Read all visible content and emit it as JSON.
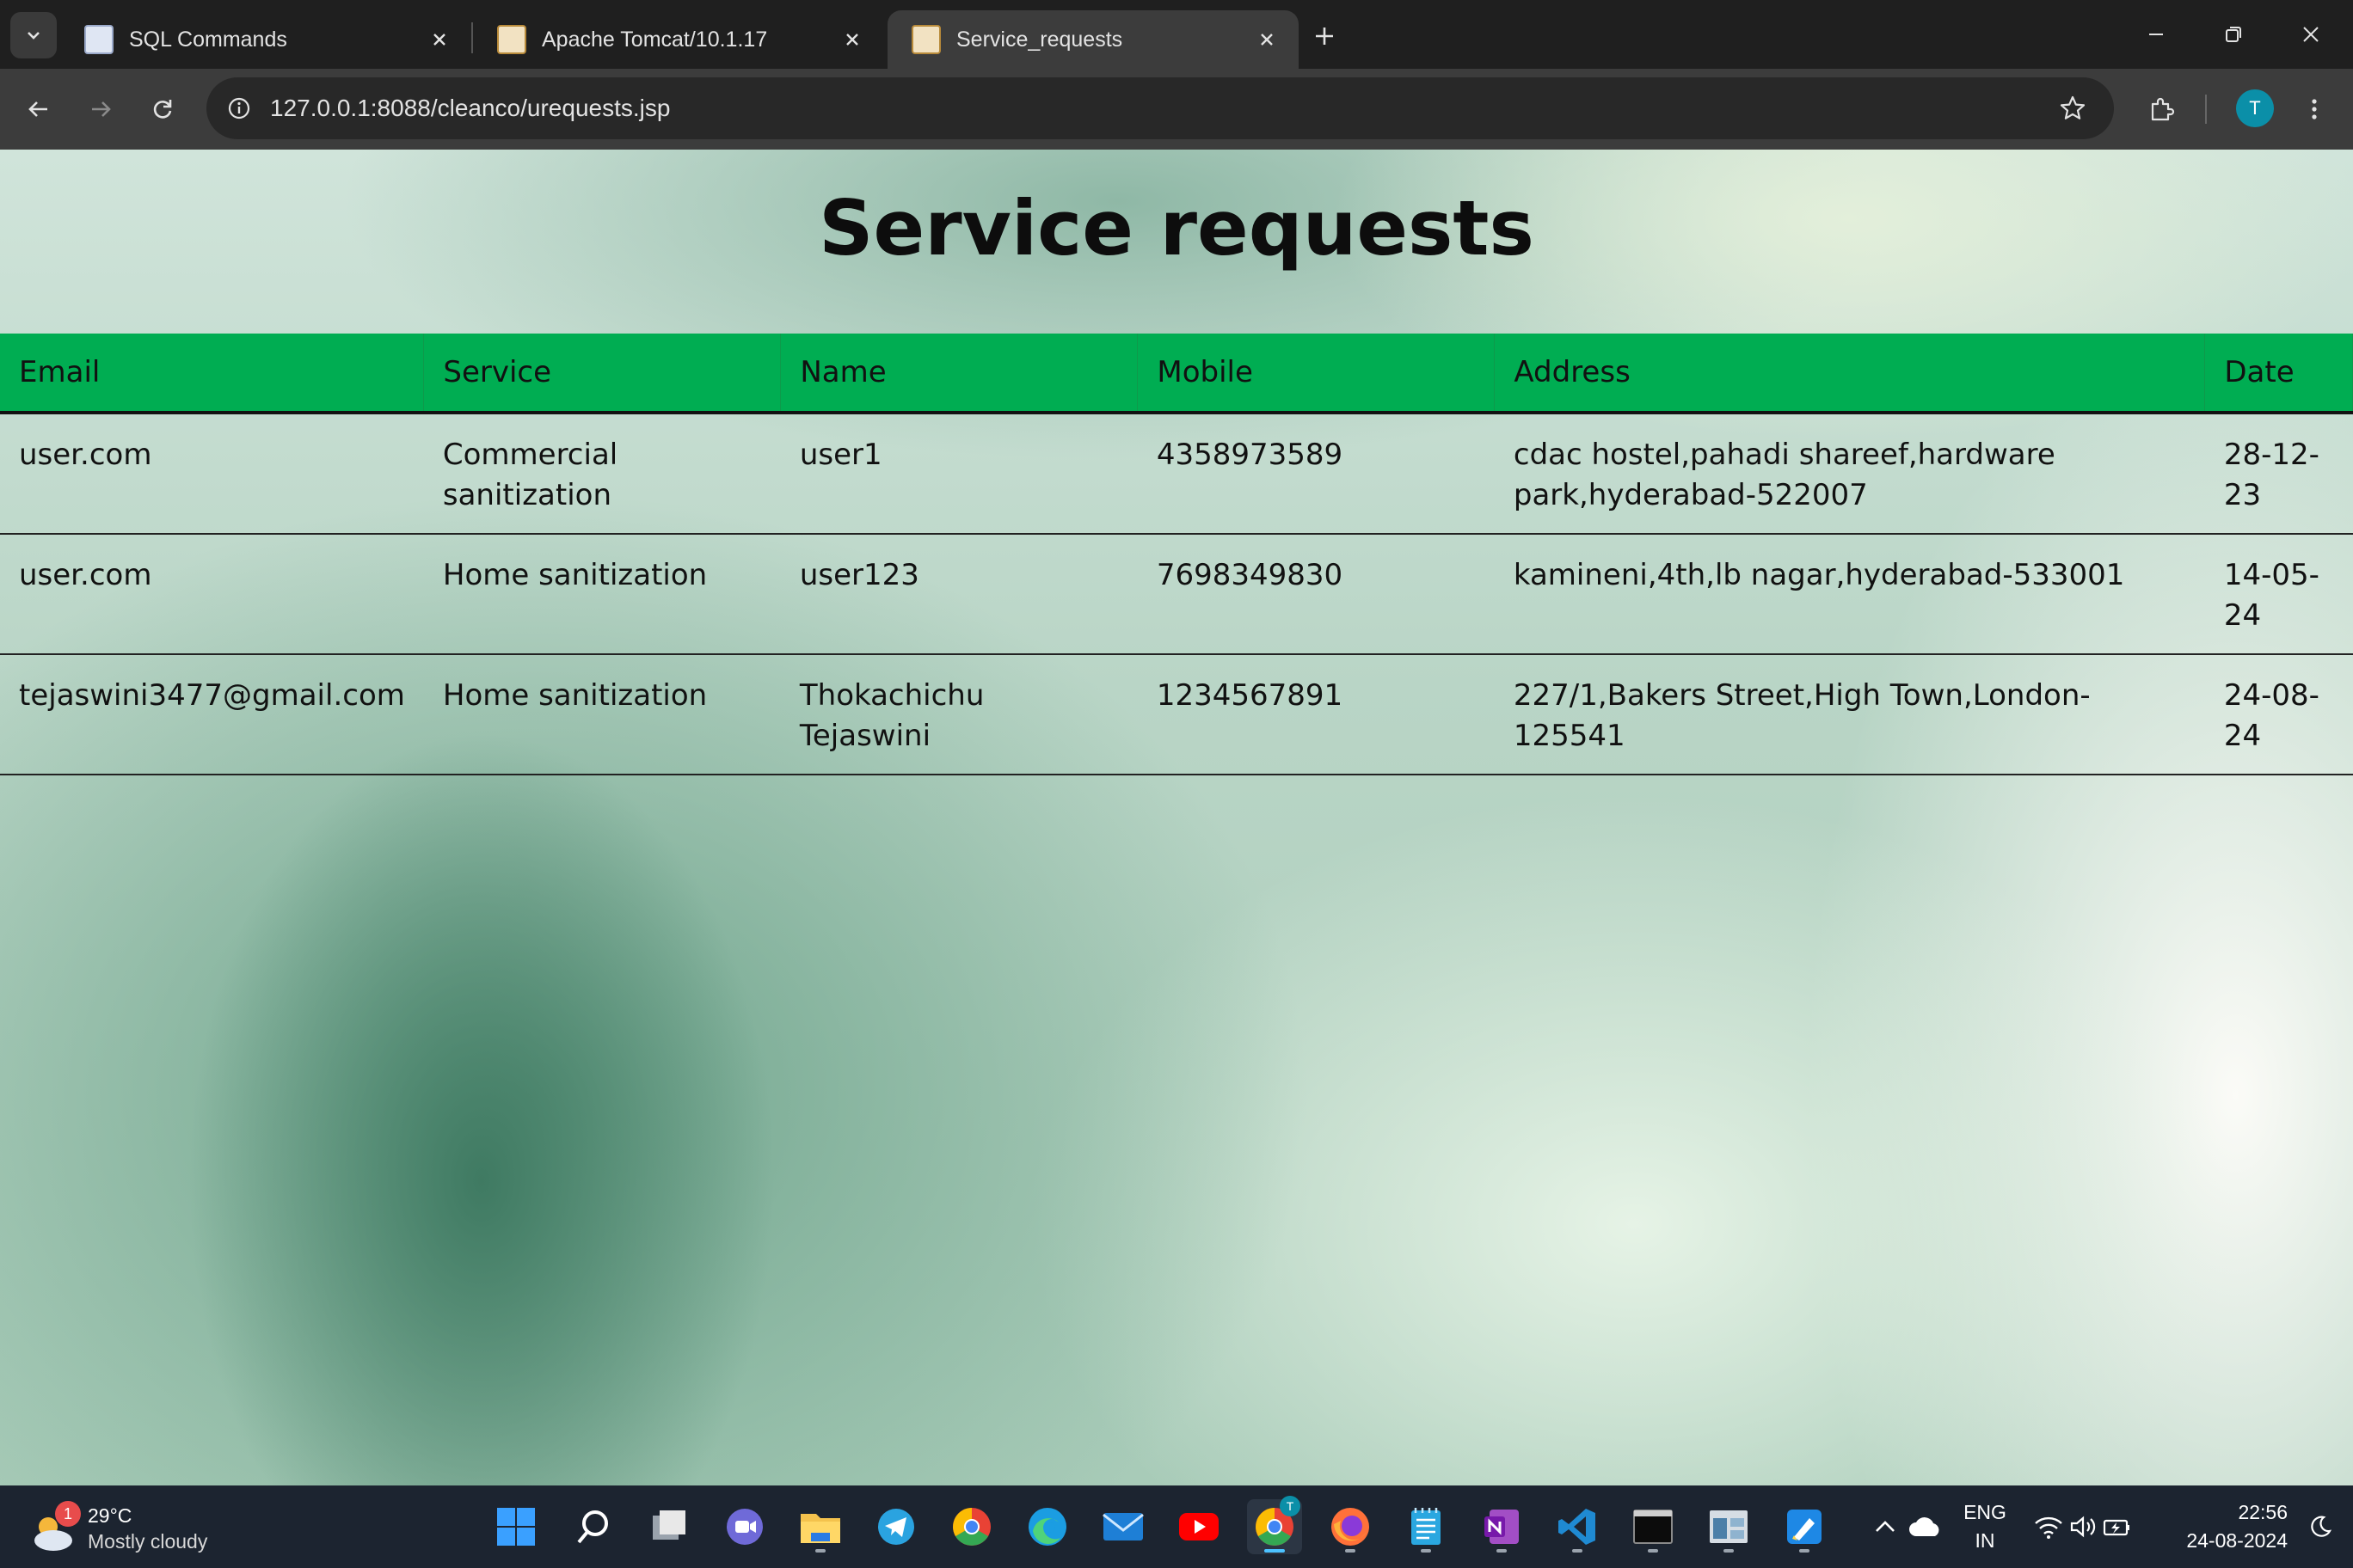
{
  "browser": {
    "tabs": [
      {
        "title": "SQL Commands",
        "active": false
      },
      {
        "title": "Apache Tomcat/10.1.17",
        "active": false
      },
      {
        "title": "Service_requests",
        "active": true
      }
    ],
    "url": "127.0.0.1:8088/cleanco/urequests.jsp",
    "profile_initial": "T"
  },
  "page": {
    "title": "Service requests",
    "table": {
      "headers": [
        "Email",
        "Service",
        "Name",
        "Mobile",
        "Address",
        "Date"
      ],
      "rows": [
        [
          "user.com",
          "Commercial sanitization",
          "user1",
          "4358973589",
          "cdac hostel,pahadi shareef,hardware park,hyderabad-522007",
          "28-12-23"
        ],
        [
          "user.com",
          "Home sanitization",
          "user123",
          "7698349830",
          "kamineni,4th,lb nagar,hyderabad-533001",
          "14-05-24"
        ],
        [
          "tejaswini3477@gmail.com",
          "Home sanitization",
          "Thokachichu Tejaswini",
          "1234567891",
          "227/1,Bakers Street,High Town,London-125541",
          "24-08-24"
        ]
      ]
    }
  },
  "taskbar": {
    "weather": {
      "temp": "29°C",
      "condition": "Mostly cloudy",
      "badge": "1"
    },
    "language": {
      "lang": "ENG",
      "region": "IN"
    },
    "clock": {
      "time": "22:56",
      "date": "24-08-2024"
    },
    "chrome_badge": "T",
    "apps": [
      "start-icon",
      "search-icon",
      "task-view-icon",
      "meet-icon",
      "file-explorer-icon",
      "telegram-icon",
      "chrome-profile-icon",
      "edge-icon",
      "mail-icon",
      "youtube-icon",
      "chrome-icon",
      "firefox-icon",
      "notepad-icon",
      "onenote-icon",
      "vscode-icon",
      "terminal-icon",
      "app-icon",
      "paint-icon"
    ]
  },
  "colors": {
    "header_green": "#00ad52",
    "tab_bg": "#1f1f1f",
    "toolbar_bg": "#3c3c3c",
    "taskbar_bg": "#1c2430"
  }
}
